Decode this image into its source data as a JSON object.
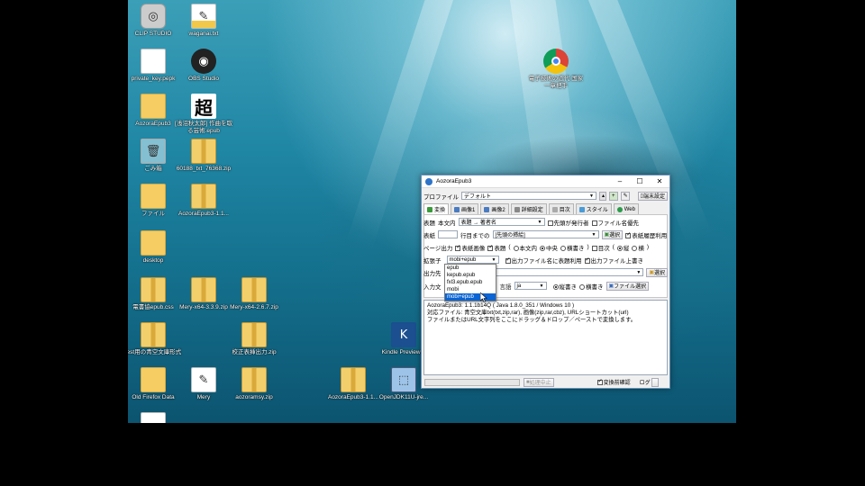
{
  "desktop": {
    "icons": [
      {
        "label": "CLIP STUDIO",
        "type": "app"
      },
      {
        "label": "waganai.txt",
        "type": "txt"
      },
      {
        "label": "private_key.pepk",
        "type": "doc"
      },
      {
        "label": "OBS Studio",
        "type": "app"
      },
      {
        "label": "AozoraEpub3",
        "type": "folder"
      },
      {
        "label": "[浅沼秋太郎] 作曲を取る芸術.epub",
        "type": "doc",
        "glyph": "超"
      },
      {
        "label": "ごみ箱",
        "type": "app"
      },
      {
        "label": "60188_txt_76368.zip",
        "type": "zip"
      },
      {
        "label": "ファイル",
        "type": "folder"
      },
      {
        "label": "AozoraEpub3-1.1...",
        "type": "zip"
      },
      {
        "label": "desktop",
        "type": "folder"
      },
      {
        "label": "電書協epub.css",
        "type": "doc"
      },
      {
        "label": "Mery-x64-3.3.9.zip",
        "type": "zip"
      },
      {
        "label": "Mery-x64-2.6.7.zip",
        "type": "zip"
      },
      {
        "label": "test用の青空文庫形式",
        "type": "doc"
      },
      {
        "label": "校正表挿出力.zip",
        "type": "zip"
      },
      {
        "label": "Kindle Previewer",
        "type": "app"
      },
      {
        "label": "Old Firefox Data",
        "type": "folder"
      },
      {
        "label": "Mery",
        "type": "app"
      },
      {
        "label": "aozoramsy.zip",
        "type": "zip"
      },
      {
        "label": "AozoraEpub3-1.1...",
        "type": "zip"
      },
      {
        "label": "OpenJDK11U-jre...",
        "type": "app"
      },
      {
        "label": "電子技術の近代 国家 一章把手",
        "type": "app"
      }
    ]
  },
  "window": {
    "title": "AozoraEpub3",
    "controls": {
      "minimize": "–",
      "maximize": "☐",
      "close": "✕"
    },
    "profile": {
      "label": "プロファイル",
      "value": "デフォルト",
      "end_label": "端末設定"
    },
    "tabs": [
      "変換",
      "画像1",
      "画像2",
      "詳細設定",
      "目次",
      "スタイル",
      "Web"
    ],
    "row_title": {
      "label": "表題",
      "sub": "本文内",
      "value": "表題 → 著者名",
      "cb1": "先頭が発行者",
      "cb2": "ファイル名優先"
    },
    "row_cover": {
      "label": "表紙",
      "mid": "行目までの",
      "value": "[先頭の挿絵]",
      "btn": "選択",
      "cb": "表紙履歴利用"
    },
    "row_page": {
      "label": "ページ出力",
      "cb1": "表紙画像",
      "cb2": "表題",
      "r1": "本文内",
      "r2": "中央",
      "r3": "横書き",
      "cb3": "目次",
      "r4": "縦",
      "r5": "横"
    },
    "row_ext": {
      "label": "拡張子",
      "value": "mobi+epub",
      "cb1": "出力ファイル名に表題利用",
      "cb2": "出力ファイル上書き"
    },
    "row_out": {
      "label": "出力先",
      "btn": "選択"
    },
    "row_input": {
      "label": "入力文",
      "lang_label": "言語",
      "lang": "ja",
      "r1": "縦書き",
      "r2": "横書き",
      "btn": "ファイル選択"
    },
    "log_lines": [
      "AozoraEpub3: 1.1.1b14Q  ( Java 1.8.0_351 / Windows 10 )",
      "対応ファイル: 青空文庫txt(txt,zip,rar), 画像(zip,rar,cbz), URLショートカット(url)",
      "ファイルまたはURL文字列をここにドラッグ＆ドロップ／ペーストで変換します。"
    ],
    "status": {
      "cancel": "処理中止",
      "confirm_cb": "変換前確認",
      "log": "ログ"
    }
  },
  "dropdown": {
    "options": [
      "epub",
      "kepub.epub",
      "fxl3.epub.epub",
      "mobi",
      "mobi+epub"
    ],
    "selected": "mobi+epub"
  }
}
